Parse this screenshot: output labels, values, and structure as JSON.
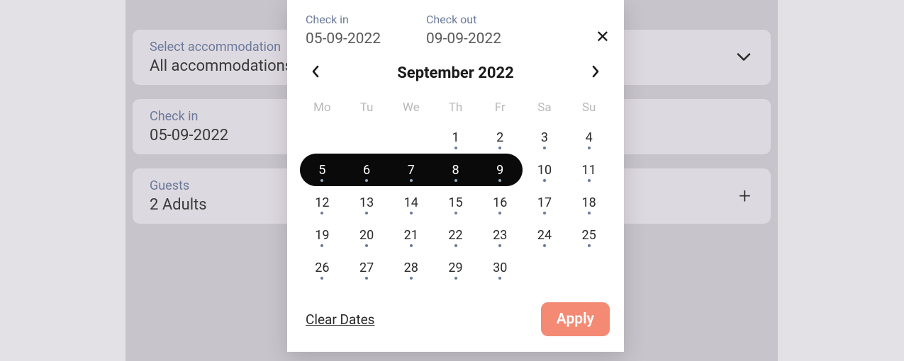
{
  "form": {
    "accommodation": {
      "label": "Select accommodation",
      "value": "All accommodations"
    },
    "checkin": {
      "label": "Check in",
      "value": "05-09-2022"
    },
    "guests": {
      "label": "Guests",
      "value": "2 Adults"
    }
  },
  "datepicker": {
    "checkin_label": "Check in",
    "checkin_value": "05-09-2022",
    "checkout_label": "Check out",
    "checkout_value": "09-09-2022",
    "month_title": "September 2022",
    "weekdays": [
      "Mo",
      "Tu",
      "We",
      "Th",
      "Fr",
      "Sa",
      "Su"
    ],
    "days": [
      [
        "",
        "",
        "",
        "1",
        "2",
        "3",
        "4"
      ],
      [
        "5",
        "6",
        "7",
        "8",
        "9",
        "10",
        "11"
      ],
      [
        "12",
        "13",
        "14",
        "15",
        "16",
        "17",
        "18"
      ],
      [
        "19",
        "20",
        "21",
        "22",
        "23",
        "24",
        "25"
      ],
      [
        "26",
        "27",
        "28",
        "29",
        "30",
        "",
        ""
      ]
    ],
    "selected_range": [
      5,
      9
    ],
    "clear_label": "Clear Dates",
    "apply_label": "Apply"
  }
}
